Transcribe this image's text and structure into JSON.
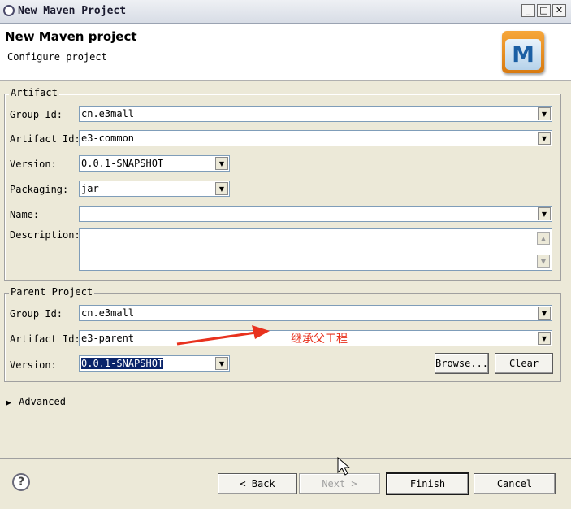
{
  "window": {
    "title": "New Maven Project",
    "minimize": "_",
    "maximize": "□",
    "close": "✕"
  },
  "header": {
    "title": "New Maven project",
    "subtitle": "Configure project",
    "logo_letter": "M"
  },
  "artifact": {
    "legend": "Artifact",
    "group_id_label": "Group Id:",
    "group_id": "cn.e3mall",
    "artifact_id_label": "Artifact Id:",
    "artifact_id": "e3-common",
    "version_label": "Version:",
    "version": "0.0.1-SNAPSHOT",
    "packaging_label": "Packaging:",
    "packaging": "jar",
    "name_label": "Name:",
    "name": "",
    "description_label": "Description:",
    "description": ""
  },
  "parent": {
    "legend": "Parent Project",
    "group_id_label": "Group Id:",
    "group_id": "cn.e3mall",
    "artifact_id_label": "Artifact Id:",
    "artifact_id": "e3-parent",
    "version_label": "Version:",
    "version": "0.0.1-SNAPSHOT",
    "browse_label": "Browse...",
    "clear_label": "Clear"
  },
  "annotation": {
    "text": "继承父工程",
    "color": "#e8321e"
  },
  "advanced": {
    "label": "Advanced"
  },
  "footer": {
    "help": "?",
    "back_label": "< Back",
    "next_label": "Next >",
    "finish_label": "Finish",
    "cancel_label": "Cancel"
  },
  "icons": {
    "dropdown": "▼",
    "scroll_up": "▲",
    "scroll_down": "▼",
    "expand": "▶"
  }
}
